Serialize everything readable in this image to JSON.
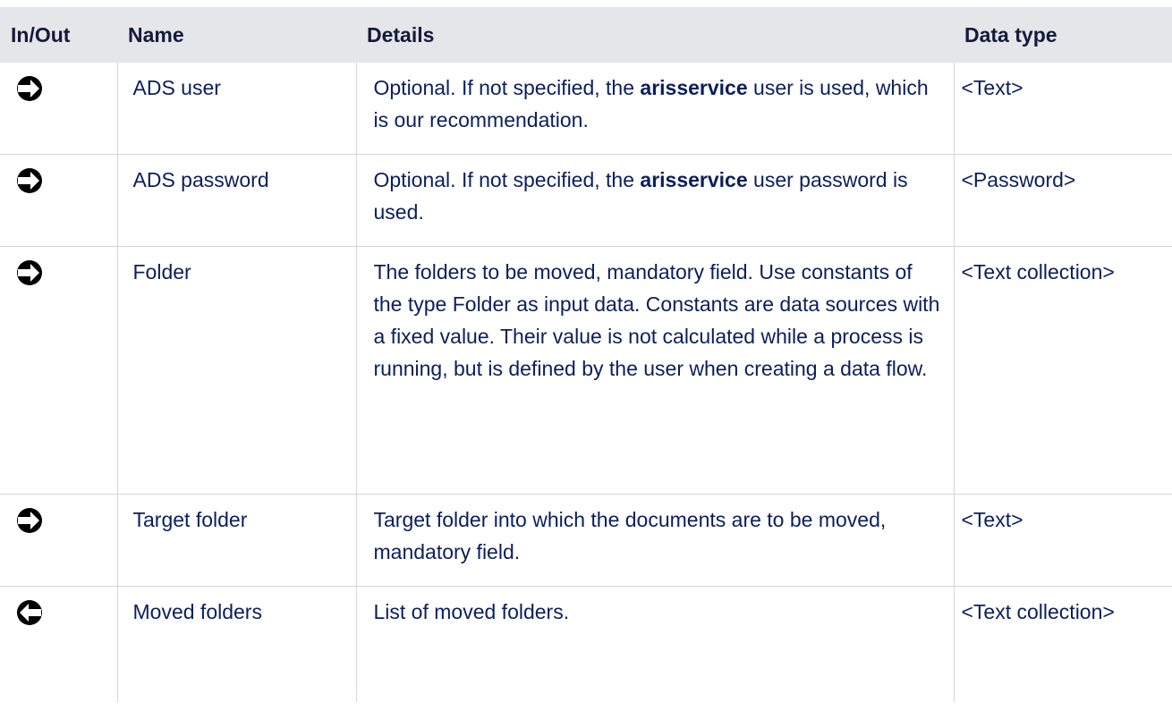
{
  "headers": {
    "in_out": "In/Out",
    "name": "Name",
    "details": "Details",
    "data_type": "Data type"
  },
  "rows": [
    {
      "direction_icon": "input-arrow-icon",
      "name": "ADS user",
      "details_pre": "Optional. If not specified, the ",
      "details_bold": "arisservice",
      "details_post": " user is used, which is our recommendation.",
      "data_type": "<Text>"
    },
    {
      "direction_icon": "input-arrow-icon",
      "name": "ADS password",
      "details_pre": "Optional. If not specified, the ",
      "details_bold": "arisservice",
      "details_post": " user password is used.",
      "data_type": "<Password>"
    },
    {
      "direction_icon": "input-arrow-icon",
      "name": "Folder",
      "details_pre": "The folders to be moved, mandatory field. Use constants of the type Folder as input data. Constants are data sources with a fixed value. Their value is not calculated while a process is running, but is defined by the user when creating a data flow.",
      "details_bold": "",
      "details_post": "",
      "data_type": "<Text collection>"
    },
    {
      "direction_icon": "input-arrow-icon",
      "name": "Target folder",
      "details_pre": "Target folder into which the documents are to be moved, mandatory field.",
      "details_bold": "",
      "details_post": "",
      "data_type": "<Text>"
    },
    {
      "direction_icon": "output-arrow-icon",
      "name": "Moved folders",
      "details_pre": "List of moved folders.",
      "details_bold": "",
      "details_post": "",
      "data_type": "<Text collection>"
    }
  ]
}
